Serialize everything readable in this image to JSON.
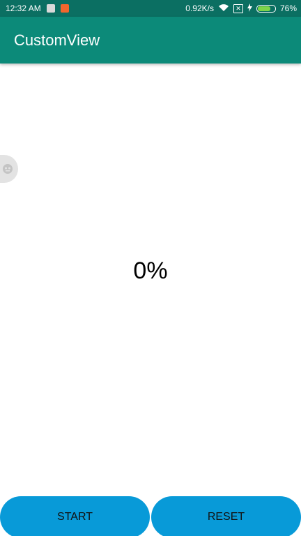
{
  "status_bar": {
    "time": "12:32 AM",
    "network_speed": "0.92K/s",
    "battery_percent": "76%",
    "battery_level": 0.76,
    "colors": {
      "background": "#0b6f62",
      "battery_fill": "#7cd44a"
    }
  },
  "toolbar": {
    "title": "CustomView",
    "color": "#0c8a79"
  },
  "progress": {
    "text": "0%",
    "value": 0
  },
  "buttons": {
    "start_label": "START",
    "reset_label": "RESET",
    "color": "#089ad8"
  }
}
